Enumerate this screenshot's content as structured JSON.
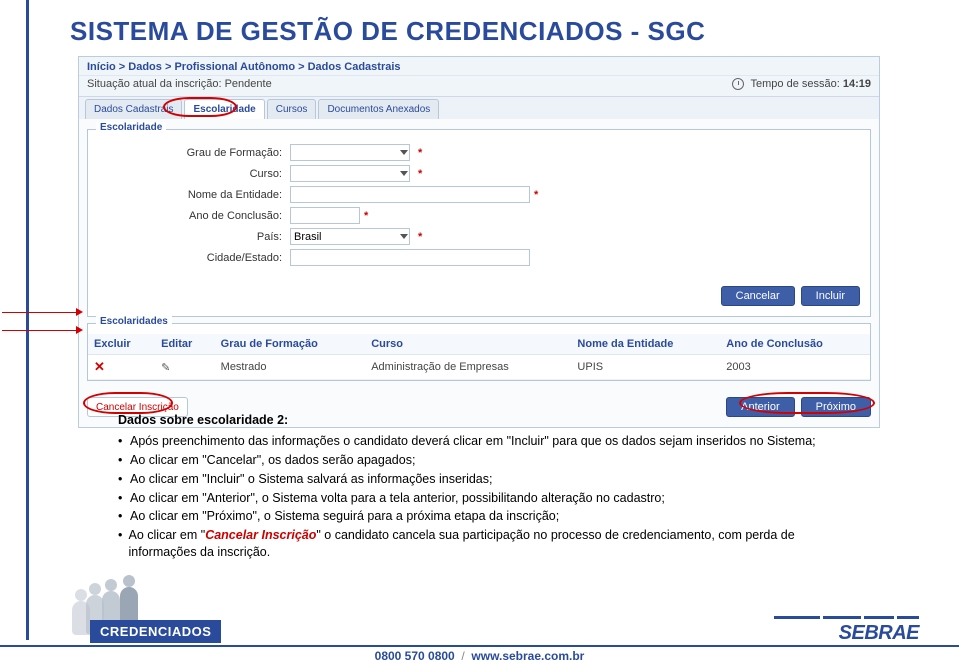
{
  "page_title": "SISTEMA DE GESTÃO DE CREDENCIADOS - SGC",
  "breadcrumb": {
    "path": [
      "Início",
      "Dados",
      "Profissional Autônomo"
    ],
    "current": "Dados Cadastrais"
  },
  "status": {
    "label": "Situação atual da inscrição:",
    "value": "Pendente",
    "session_label": "Tempo de sessão:",
    "session_value": "14:19"
  },
  "tabs": [
    {
      "label": "Dados Cadastrais",
      "active": false
    },
    {
      "label": "Escolaridade",
      "active": true
    },
    {
      "label": "Cursos",
      "active": false
    },
    {
      "label": "Documentos Anexados",
      "active": false
    }
  ],
  "form": {
    "section_title": "Escolaridade",
    "fields": {
      "grau_label": "Grau de Formação:",
      "grau_value": "",
      "curso_label": "Curso:",
      "curso_value": "",
      "entidade_label": "Nome da Entidade:",
      "entidade_value": "",
      "ano_label": "Ano de Conclusão:",
      "ano_value": "",
      "pais_label": "País:",
      "pais_value": "Brasil",
      "cidade_label": "Cidade/Estado:",
      "cidade_value": ""
    },
    "buttons": {
      "cancel": "Cancelar",
      "include": "Incluir"
    }
  },
  "table": {
    "section_title": "Escolaridades",
    "headers": [
      "Excluir",
      "Editar",
      "Grau de Formação",
      "Curso",
      "Nome da Entidade",
      "Ano de Conclusão"
    ],
    "rows": [
      {
        "grau": "Mestrado",
        "curso": "Administração de Empresas",
        "entidade": "UPIS",
        "ano": "2003"
      }
    ]
  },
  "bottom": {
    "cancel_inscription": "Cancelar Inscrição",
    "prev": "Anterior",
    "next": "Próximo"
  },
  "description": {
    "heading": "Dados sobre escolaridade 2:",
    "bullets": [
      "Após preenchimento das informações o candidato deverá clicar em \"Incluir\" para que os dados sejam inseridos no Sistema;",
      "Ao clicar em \"Cancelar\", os dados serão apagados;",
      "Ao clicar em \"Incluir\" o Sistema salvará as informações inseridas;",
      "Ao clicar em \"Anterior\", o Sistema volta para a tela anterior, possibilitando alteração no cadastro;",
      "Ao clicar em \"Próximo\", o Sistema seguirá para a próxima etapa da inscrição;"
    ],
    "bullet_cancel_pre": "Ao clicar em \"",
    "bullet_cancel_red": "Cancelar Inscrição",
    "bullet_cancel_post": "\" o candidato cancela sua participação no processo de credenciamento, com perda de informações da inscrição."
  },
  "footer": {
    "cred_box": "CREDENCIADOS",
    "logo_text": "SEBRAE",
    "phone": "0800 570 0800",
    "sep": "/",
    "url": "www.sebrae.com.br"
  }
}
